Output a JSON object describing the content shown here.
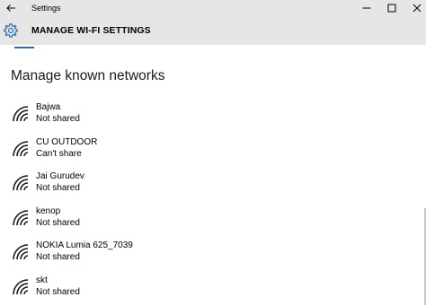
{
  "window": {
    "title": "Settings",
    "back_icon": "back-arrow-icon",
    "controls": [
      "minimize-icon",
      "maximize-icon",
      "close-icon"
    ]
  },
  "header": {
    "icon": "gear-icon",
    "title": "MANAGE WI-FI SETTINGS"
  },
  "section": {
    "title": "Manage known networks"
  },
  "networks": [
    {
      "name": "Bajwa",
      "status": "Not shared"
    },
    {
      "name": "CU OUTDOOR",
      "status": "Can't share"
    },
    {
      "name": "Jai Gurudev",
      "status": "Not shared"
    },
    {
      "name": "kenop",
      "status": "Not shared"
    },
    {
      "name": "NOKIA Lumia 625_7039",
      "status": "Not shared"
    },
    {
      "name": "skt",
      "status": "Not shared"
    }
  ],
  "colors": {
    "titlebar_bg": "#e6e6e6",
    "accent": "#2b6cb0"
  }
}
